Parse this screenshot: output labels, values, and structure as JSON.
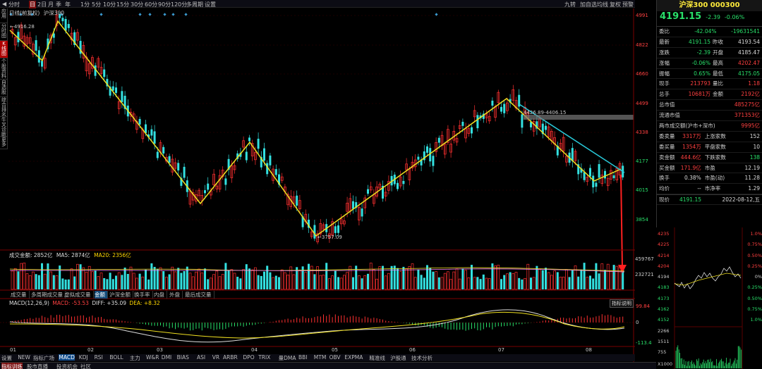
{
  "topbar": {
    "items": [
      "分时",
      "日",
      "2日",
      "月",
      "季",
      "年",
      "1分",
      "5分",
      "10分",
      "15分",
      "30分",
      "60分",
      "90分",
      "120分",
      "多周期",
      "设置"
    ],
    "active": 1,
    "right_items": [
      "九转",
      "加自选",
      "均线",
      "复权",
      "预警"
    ]
  },
  "lefttabs": [
    "应用",
    "分时图",
    "K线图",
    "个股资料",
    "自选股",
    "综合排名",
    "牛叉诊断",
    "更多"
  ],
  "chart": {
    "title": "日线(前复权)",
    "symbol": "沪深300",
    "y_ticks": [
      "4991",
      "4822",
      "4660",
      "4499",
      "4338",
      "4177",
      "4015",
      "3854"
    ],
    "high_label": "4916.28",
    "low_label": "3757.09",
    "gap_label": "4426.89-4406.15",
    "months": [
      "01",
      "02",
      "03",
      "04",
      "05",
      "06",
      "07",
      "08"
    ]
  },
  "volume": {
    "label": "成交金额: 2852亿",
    "ma5": "MA5: 2874亿",
    "ma20": "MA20: 2356亿",
    "y_ticks": [
      "459767",
      "232721"
    ],
    "tabs": [
      "成交量",
      "多周期成交量",
      "虚拟成交量",
      "金额",
      "沪深金额",
      "换手率",
      "内盘",
      "外盘",
      "最后成交量"
    ],
    "active": 3
  },
  "macd": {
    "label": "MACD(12,26,9)",
    "macd": "MACD: -53.53",
    "diff": "DIFF: +35.09",
    "dea": "DEA: +8.32",
    "button": "指标说明",
    "y_ticks": [
      "99.84",
      "0",
      "-113.4"
    ]
  },
  "indicators": [
    "设置",
    "NEW",
    "指标广场",
    "MACD",
    "KDJ",
    "RSI",
    "BOLL",
    "主力",
    "W&R",
    "DMI",
    "BIAS",
    "ASI",
    "VR",
    "ARBR",
    "DPO",
    "TRIX",
    "量DMA",
    "BBI",
    "MTM",
    "OBV",
    "EXPMA",
    "精准线",
    "沪股通",
    "技术分析"
  ],
  "bottom": [
    "指标训练",
    "股市直播",
    "投资机会",
    "社区"
  ],
  "right": {
    "title": "沪深300 000300",
    "price": "4191.15",
    "change": "-2.39",
    "pct": "-0.06%",
    "weibi": {
      "label": "委比",
      "v1": "-42.04%",
      "v2": "-19631541"
    },
    "grid": [
      [
        "最新",
        "4191.15",
        "昨收",
        "4193.54"
      ],
      [
        "涨跌",
        "-2.39",
        "开盘",
        "4185.47"
      ],
      [
        "涨幅",
        "-0.06%",
        "最高",
        "4202.47"
      ],
      [
        "振幅",
        "0.65%",
        "最低",
        "4175.05"
      ],
      [
        "现手",
        "213793",
        "量比",
        "1.18"
      ],
      [
        "总手",
        "10681万",
        "金额",
        "2192亿"
      ]
    ],
    "list": [
      [
        "总市值",
        "485275亿"
      ],
      [
        "流通市值",
        "371353亿"
      ],
      [
        "两市成交额(沪市+深市)",
        "9995亿"
      ]
    ],
    "list2": [
      [
        "委卖量",
        "3317万",
        "上涨家数",
        "152"
      ],
      [
        "委买量",
        "1354万",
        "平盘家数",
        "10"
      ],
      [
        "卖金额",
        "444.6亿",
        "下跌家数",
        "138"
      ],
      [
        "买金额",
        "171.9亿",
        "市盈",
        "12.19"
      ],
      [
        "换手",
        "0.38%",
        "市盈(动)",
        "11.28"
      ],
      [
        "均价",
        "--",
        "市净率",
        "1.29"
      ]
    ],
    "now": {
      "label": "现价",
      "price": "4191.15",
      "date": "2022-08-12,五"
    },
    "mini": {
      "y_left": [
        "4235",
        "4225",
        "4214",
        "4204",
        "4194",
        "4183",
        "4173",
        "4162",
        "4152"
      ],
      "y_right": [
        "1.0%",
        "0.75%",
        "0.50%",
        "0.25%",
        "0%",
        "0.25%",
        "0.50%",
        "0.75%",
        "1.0%"
      ],
      "vol": [
        "2266",
        "1511",
        "755"
      ],
      "units": "X1000"
    }
  },
  "colors": {
    "up": "#ff3030",
    "down": "#33e0e0",
    "yellow": "#f0e020",
    "cyan": "#28c8d8",
    "red_arrow": "#ff2020"
  },
  "chart_data": {
    "type": "candlestick",
    "note": "沪深300 daily, Jan-Aug 2022"
  }
}
